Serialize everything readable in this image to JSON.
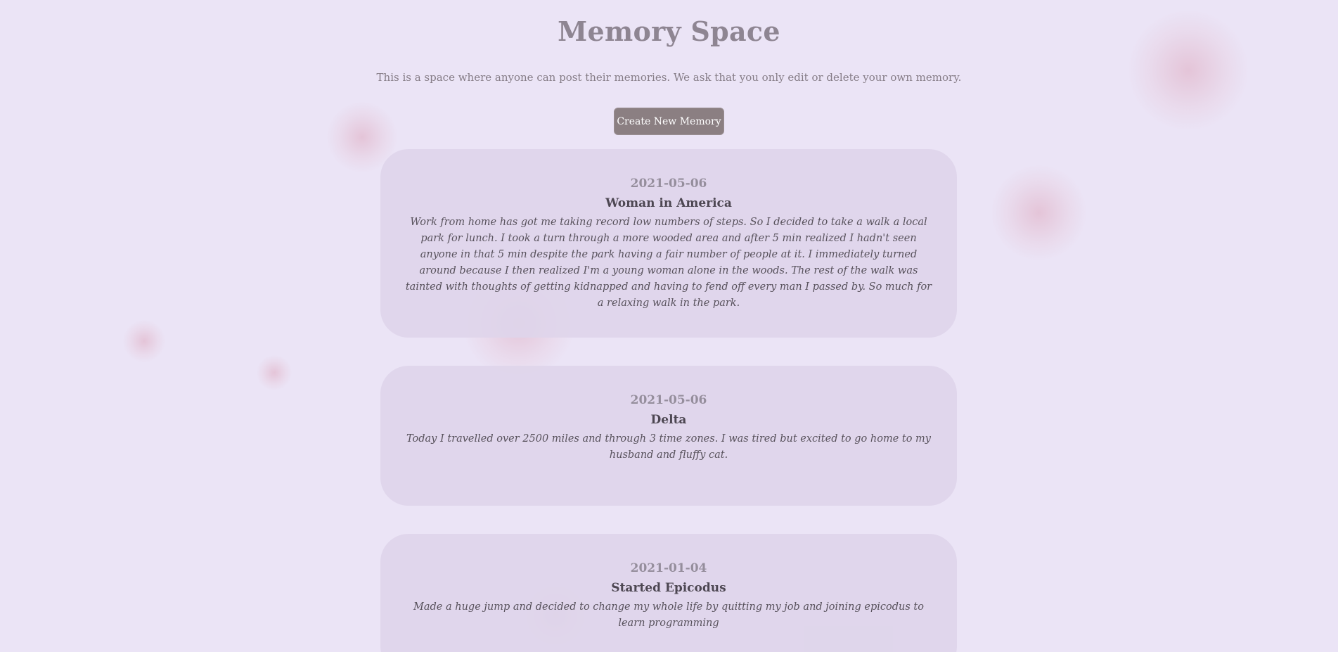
{
  "header": {
    "title": "Memory Space",
    "subtitle": "This is a space where anyone can post their memories. We ask that you only edit or delete your own memory.",
    "create_button_label": "Create New Memory"
  },
  "memories": [
    {
      "date": "2021-05-06",
      "title": "Woman in America",
      "body": "Work from home has got me taking record low numbers of steps. So I decided to take a walk a local park for lunch. I took a turn through a more wooded area and after 5 min realized I hadn't seen anyone in that 5 min despite the park having a fair number of people at it. I immediately turned around because I then realized I'm a young woman alone in the woods. The rest of the walk was tainted with thoughts of getting kidnapped and having to fend off every man I passed by. So much for a relaxing walk in the park."
    },
    {
      "date": "2021-05-06",
      "title": "Delta",
      "body": "Today I travelled over 2500 miles and through 3 time zones. I was tired but excited to go home to my husband and fluffy cat."
    },
    {
      "date": "2021-01-04",
      "title": "Started Epicodus",
      "body": "Made a huge jump and decided to change my whole life by quitting my job and joining epicodus to learn programming"
    }
  ],
  "colors": {
    "background": "#ebe4f6",
    "card": "#ded5ea",
    "button": "#8b7f82",
    "title": "#8e8592"
  }
}
